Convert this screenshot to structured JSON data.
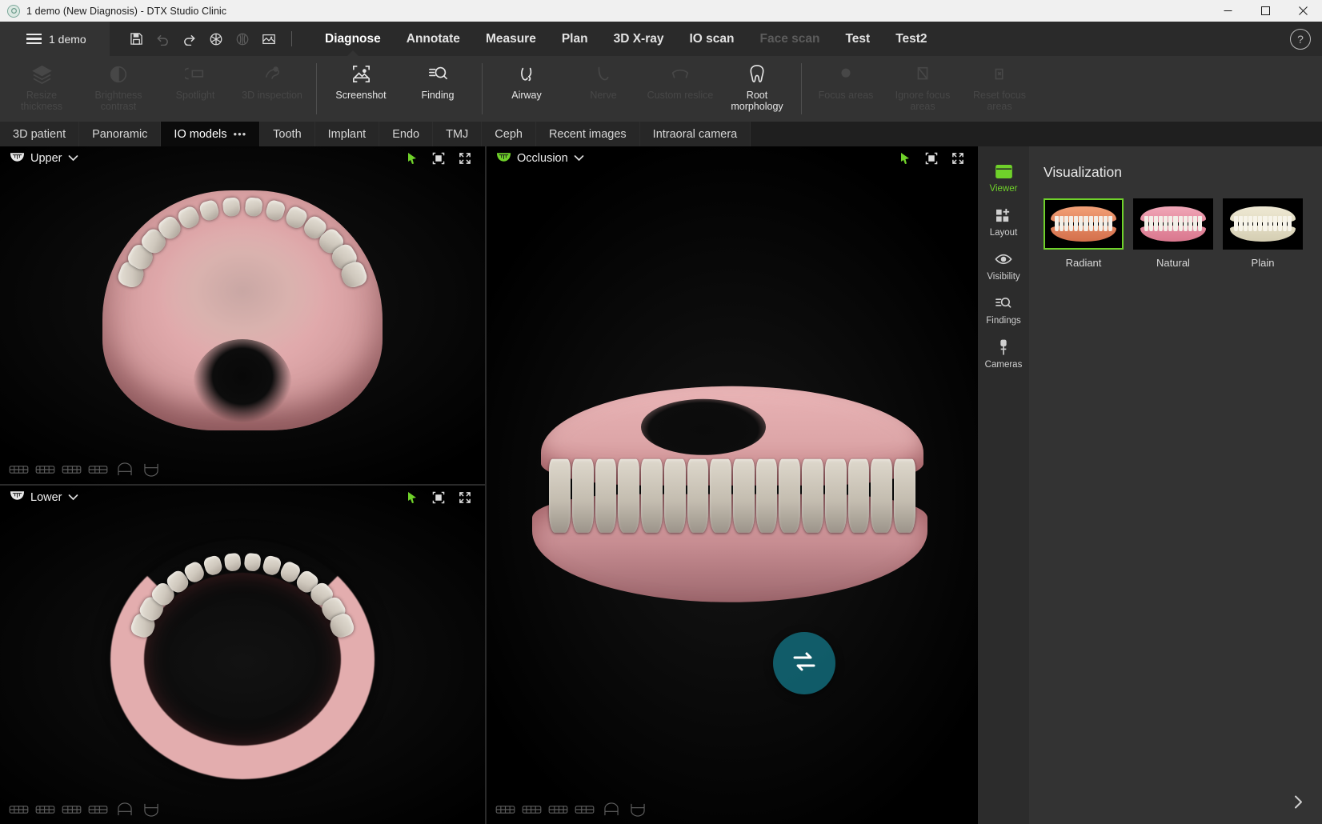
{
  "window": {
    "title": "1 demo (New Diagnosis) - DTX Studio Clinic",
    "app_icon": "dtx-logo-icon",
    "minimize_label": "Minimize",
    "maximize_label": "Maximize",
    "close_label": "Close"
  },
  "menubar": {
    "project_label": "1 demo",
    "quick_tools": [
      {
        "name": "save-button",
        "icon": "floppy-disk-icon",
        "enabled": true
      },
      {
        "name": "undo-button",
        "icon": "undo-arrow-icon",
        "enabled": false
      },
      {
        "name": "redo-button",
        "icon": "redo-arrow-icon",
        "enabled": true
      },
      {
        "name": "volume-render-button",
        "icon": "aperture-icon",
        "enabled": true
      },
      {
        "name": "brain-render-button",
        "icon": "brain-icon",
        "enabled": false
      },
      {
        "name": "image-gallery-button",
        "icon": "image-icon",
        "enabled": true
      }
    ],
    "items": [
      {
        "label": "Diagnose",
        "active": true,
        "enabled": true
      },
      {
        "label": "Annotate",
        "active": false,
        "enabled": true
      },
      {
        "label": "Measure",
        "active": false,
        "enabled": true
      },
      {
        "label": "Plan",
        "active": false,
        "enabled": true
      },
      {
        "label": "3D X-ray",
        "active": false,
        "enabled": true
      },
      {
        "label": "IO scan",
        "active": false,
        "enabled": true
      },
      {
        "label": "Face scan",
        "active": false,
        "enabled": false
      },
      {
        "label": "Test",
        "active": false,
        "enabled": true
      },
      {
        "label": "Test2",
        "active": false,
        "enabled": true
      }
    ],
    "help_label": "?"
  },
  "ribbon": {
    "groups": [
      {
        "items": [
          {
            "label": "Resize thickness",
            "icon": "layers-icon",
            "enabled": false
          },
          {
            "label": "Brightness contrast",
            "icon": "contrast-circle-icon",
            "enabled": false
          },
          {
            "label": "Spotlight",
            "icon": "spotlight-icon",
            "enabled": false
          },
          {
            "label": "3D inspection",
            "icon": "3d-inspection-icon",
            "enabled": false
          }
        ]
      },
      {
        "items": [
          {
            "label": "Screenshot",
            "icon": "screenshot-icon",
            "enabled": true
          },
          {
            "label": "Finding",
            "icon": "finding-magnifier-icon",
            "enabled": true
          }
        ]
      },
      {
        "items": [
          {
            "label": "Airway",
            "icon": "airway-icon",
            "enabled": true
          },
          {
            "label": "Nerve",
            "icon": "nerve-icon",
            "enabled": false
          },
          {
            "label": "Custom reslice",
            "icon": "custom-reslice-icon",
            "enabled": false
          },
          {
            "label": "Root morphology",
            "icon": "tooth-icon",
            "enabled": true
          }
        ]
      },
      {
        "items": [
          {
            "label": "Focus areas",
            "icon": "focus-area-icon",
            "enabled": false
          },
          {
            "label": "Ignore focus areas",
            "icon": "ignore-focus-icon",
            "enabled": false
          },
          {
            "label": "Reset focus areas",
            "icon": "reset-focus-icon",
            "enabled": false
          }
        ]
      }
    ]
  },
  "tabs": [
    {
      "label": "3D patient",
      "active": false,
      "has_menu": false
    },
    {
      "label": "Panoramic",
      "active": false,
      "has_menu": false
    },
    {
      "label": "IO models",
      "active": true,
      "has_menu": true,
      "menu_glyph": "•••"
    },
    {
      "label": "Tooth",
      "active": false,
      "has_menu": false
    },
    {
      "label": "Implant",
      "active": false,
      "has_menu": false
    },
    {
      "label": "Endo",
      "active": false,
      "has_menu": false
    },
    {
      "label": "TMJ",
      "active": false,
      "has_menu": false
    },
    {
      "label": "Ceph",
      "active": false,
      "has_menu": false
    },
    {
      "label": "Recent images",
      "active": false,
      "has_menu": false
    },
    {
      "label": "Intraoral camera",
      "active": false,
      "has_menu": false
    }
  ],
  "viewports": {
    "upper": {
      "title": "Upper",
      "jaw_icon": "upper-jaw-icon",
      "jaw_icon_active": false,
      "dropdown_glyph": "⌄",
      "controls": [
        {
          "name": "pointer-tool-button",
          "icon": "cursor-arrow-icon",
          "accent": "#6fd12a"
        },
        {
          "name": "fit-to-view-button",
          "icon": "fit-crop-icon",
          "accent": "#dcdcdc"
        },
        {
          "name": "maximize-viewport-button",
          "icon": "expand-arrows-icon",
          "accent": "#dcdcdc"
        }
      ]
    },
    "lower": {
      "title": "Lower",
      "jaw_icon": "lower-jaw-icon",
      "jaw_icon_active": false,
      "dropdown_glyph": "⌄",
      "controls": [
        {
          "name": "pointer-tool-button",
          "icon": "cursor-arrow-icon",
          "accent": "#6fd12a"
        },
        {
          "name": "fit-to-view-button",
          "icon": "fit-crop-icon",
          "accent": "#dcdcdc"
        },
        {
          "name": "maximize-viewport-button",
          "icon": "expand-arrows-icon",
          "accent": "#dcdcdc"
        }
      ]
    },
    "occlusion": {
      "title": "Occlusion",
      "jaw_icon": "occlusion-jaw-icon",
      "jaw_icon_active": true,
      "dropdown_glyph": "⌄",
      "rotate_button_icon": "swap-rotate-icon",
      "rotate_button_color": "#126e7e",
      "controls": [
        {
          "name": "pointer-tool-button",
          "icon": "cursor-arrow-icon",
          "accent": "#6fd12a"
        },
        {
          "name": "fit-to-view-button",
          "icon": "fit-crop-icon",
          "accent": "#dcdcdc"
        },
        {
          "name": "maximize-viewport-button",
          "icon": "expand-arrows-icon",
          "accent": "#dcdcdc"
        }
      ]
    },
    "view_presets": [
      {
        "name": "view-preset-front-icon"
      },
      {
        "name": "view-preset-right-icon"
      },
      {
        "name": "view-preset-left-icon"
      },
      {
        "name": "view-preset-back-icon"
      },
      {
        "name": "view-preset-upper-arch-icon"
      },
      {
        "name": "view-preset-lower-arch-icon"
      }
    ]
  },
  "rail": {
    "items": [
      {
        "label": "Viewer",
        "icon": "viewer-window-icon",
        "active": true
      },
      {
        "label": "Layout",
        "icon": "layout-grid-icon",
        "active": false
      },
      {
        "label": "Visibility",
        "icon": "eye-icon",
        "active": false
      },
      {
        "label": "Findings",
        "icon": "findings-magnifier-icon",
        "active": false
      },
      {
        "label": "Cameras",
        "icon": "camera-plug-icon",
        "active": false
      }
    ],
    "active_color": "#6fd12a"
  },
  "panel": {
    "title": "Visualization",
    "collapse_glyph": "›",
    "options": [
      {
        "label": "Radiant",
        "selected": true
      },
      {
        "label": "Natural",
        "selected": false
      },
      {
        "label": "Plain",
        "selected": false
      }
    ],
    "selection_color": "#6fd12a"
  }
}
